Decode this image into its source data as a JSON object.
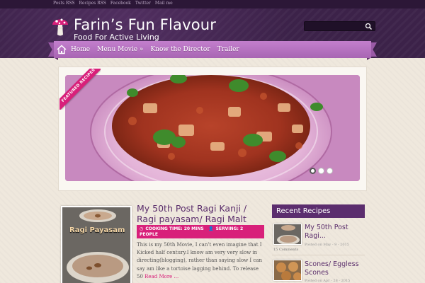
{
  "colors": {
    "header": "#3c2249",
    "ribbon": "#b06db9",
    "accent_pink": "#d8207a",
    "title_purple": "#5a2d6b",
    "widget_header": "#5b2d6e"
  },
  "topbar": {
    "links": [
      "Posts RSS",
      "Recipes RSS",
      "Facebook",
      "Twitter",
      "Mail me"
    ]
  },
  "header": {
    "logo_icon": "mushroom-icon",
    "title": "Farin’s Fun Flavour",
    "tagline": "Food For Active Living"
  },
  "search": {
    "placeholder": "",
    "icon": "search-icon"
  },
  "nav": {
    "home_icon": "home-icon",
    "items": [
      "Home",
      "Menu Movie »",
      "Know the Director",
      "Trailer"
    ]
  },
  "slider": {
    "badge": "FEATURED RECIPES",
    "dots": 3,
    "active_dot": 1
  },
  "post": {
    "thumb_text": "Ragi Payasam",
    "title": "My 50th Post Ragi Kanji / Ragi payasam/ Ragi Malt",
    "cooking_time": "COOKING TIME: 20 MINS",
    "serving": "SERVING: 2 PEOPLE",
    "excerpt": "This is my 50th Movie, I can’t even imagine that I Kicked half century.I know am very very slow in directing(blogging), rather than saying slow I can say am like a tortoise lagging behind. To release 50",
    "read_more": "Read More ..."
  },
  "sidebar": {
    "title": "Recent Recipes",
    "items": [
      {
        "title": "My 50th Post Ragi...",
        "date": "Posted on May - 9 - 2015",
        "comments": "15 Comments"
      },
      {
        "title": "Scones/ Eggless Scones",
        "date": "Posted on Apr - 28 - 2015"
      }
    ]
  }
}
